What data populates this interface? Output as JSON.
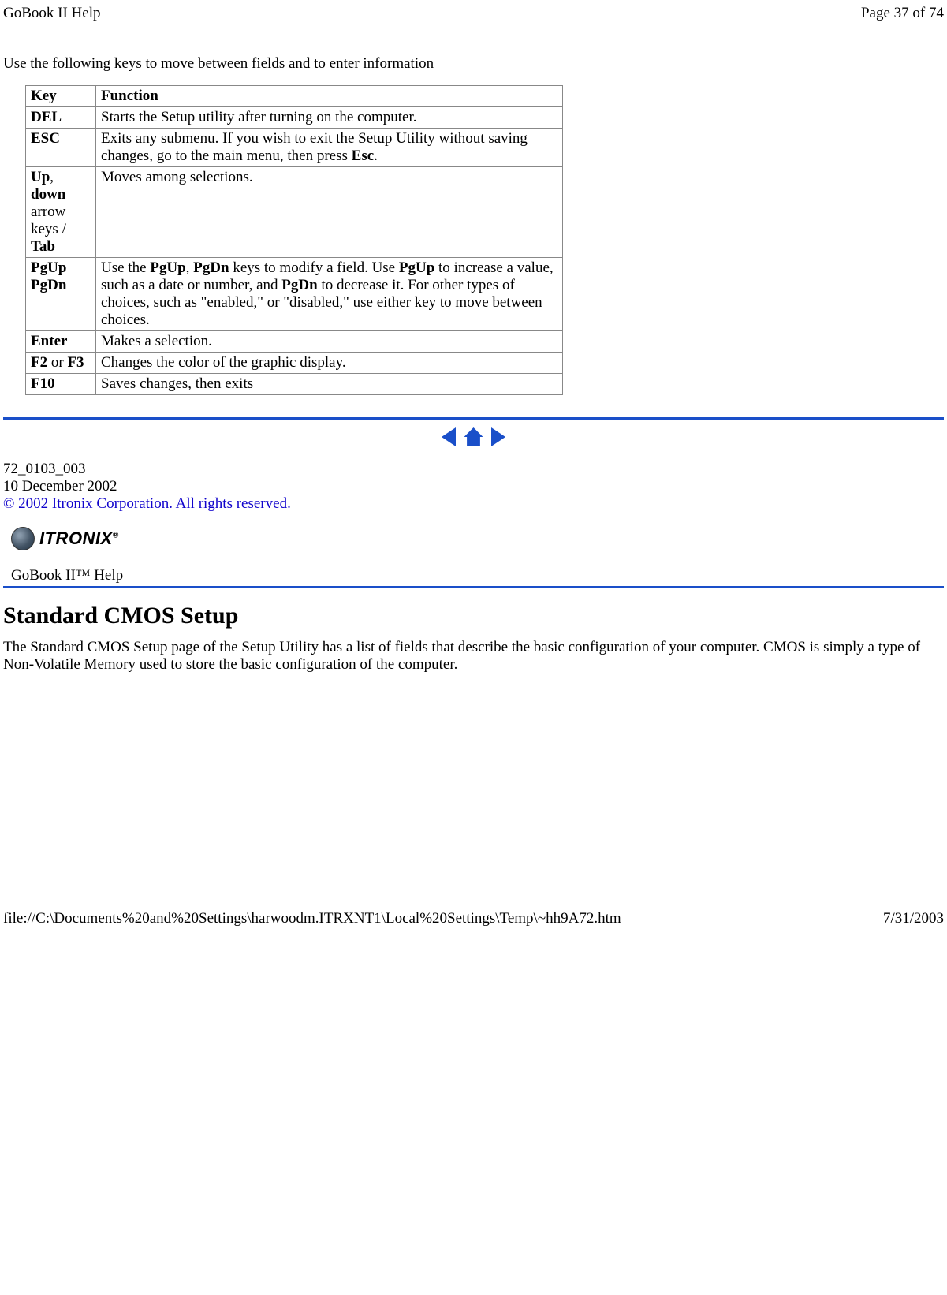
{
  "header": {
    "left": "GoBook II Help",
    "right": "Page 37 of 74"
  },
  "intro": "Use the following keys to move between fields and to enter information",
  "table": {
    "headers": {
      "key": "Key",
      "function": "Function"
    },
    "rows": [
      {
        "key_parts": [
          [
            "DEL"
          ]
        ],
        "func_parts": [
          "Starts the Setup utility after turning on the computer."
        ]
      },
      {
        "key_parts": [
          [
            "ESC"
          ]
        ],
        "func_parts": [
          "Exits any submenu.  If you wish to exit the Setup Utility without saving changes, go to the main menu, then press ",
          [
            "Esc"
          ],
          "."
        ]
      },
      {
        "key_parts": [
          [
            "Up"
          ],
          ", ",
          [
            "down"
          ],
          " arrow keys / ",
          [
            "Tab"
          ]
        ],
        "func_parts": [
          "Moves among selections."
        ]
      },
      {
        "key_parts": [
          [
            "PgUp PgDn"
          ]
        ],
        "func_parts": [
          "Use the ",
          [
            "PgUp"
          ],
          ", ",
          [
            "PgDn"
          ],
          " keys to modify a field.  Use ",
          [
            "PgUp"
          ],
          " to increase a value, such as a date or number, and ",
          [
            "PgDn"
          ],
          " to decrease it.  For other types of choices, such as \"enabled,\" or \"disabled,\" use either key to move between choices."
        ]
      },
      {
        "key_parts": [
          [
            "Enter"
          ]
        ],
        "func_parts": [
          "Makes a selection."
        ]
      },
      {
        "key_parts": [
          [
            "F2"
          ],
          " or ",
          [
            "F3"
          ]
        ],
        "func_parts": [
          "Changes the color of the graphic display."
        ]
      },
      {
        "key_parts": [
          [
            "F10"
          ]
        ],
        "func_parts": [
          "Saves changes, then exits"
        ]
      }
    ]
  },
  "doc": {
    "id": "72_0103_003",
    "date": "10 December 2002",
    "copyright": "© 2002 Itronix Corporation.  All rights reserved."
  },
  "brand": {
    "name": "ITRONIX",
    "mark": "®"
  },
  "help_title": "GoBook II™ Help",
  "section_heading": "Standard CMOS Setup",
  "section_body": "The Standard CMOS Setup page of the Setup Utility has a list of fields that describe the basic configuration of your computer.  CMOS is simply a type of Non-Volatile Memory used to store the basic configuration of the computer.",
  "footer": {
    "left": "file://C:\\Documents%20and%20Settings\\harwoodm.ITRXNT1\\Local%20Settings\\Temp\\~hh9A72.htm",
    "right": "7/31/2003"
  }
}
